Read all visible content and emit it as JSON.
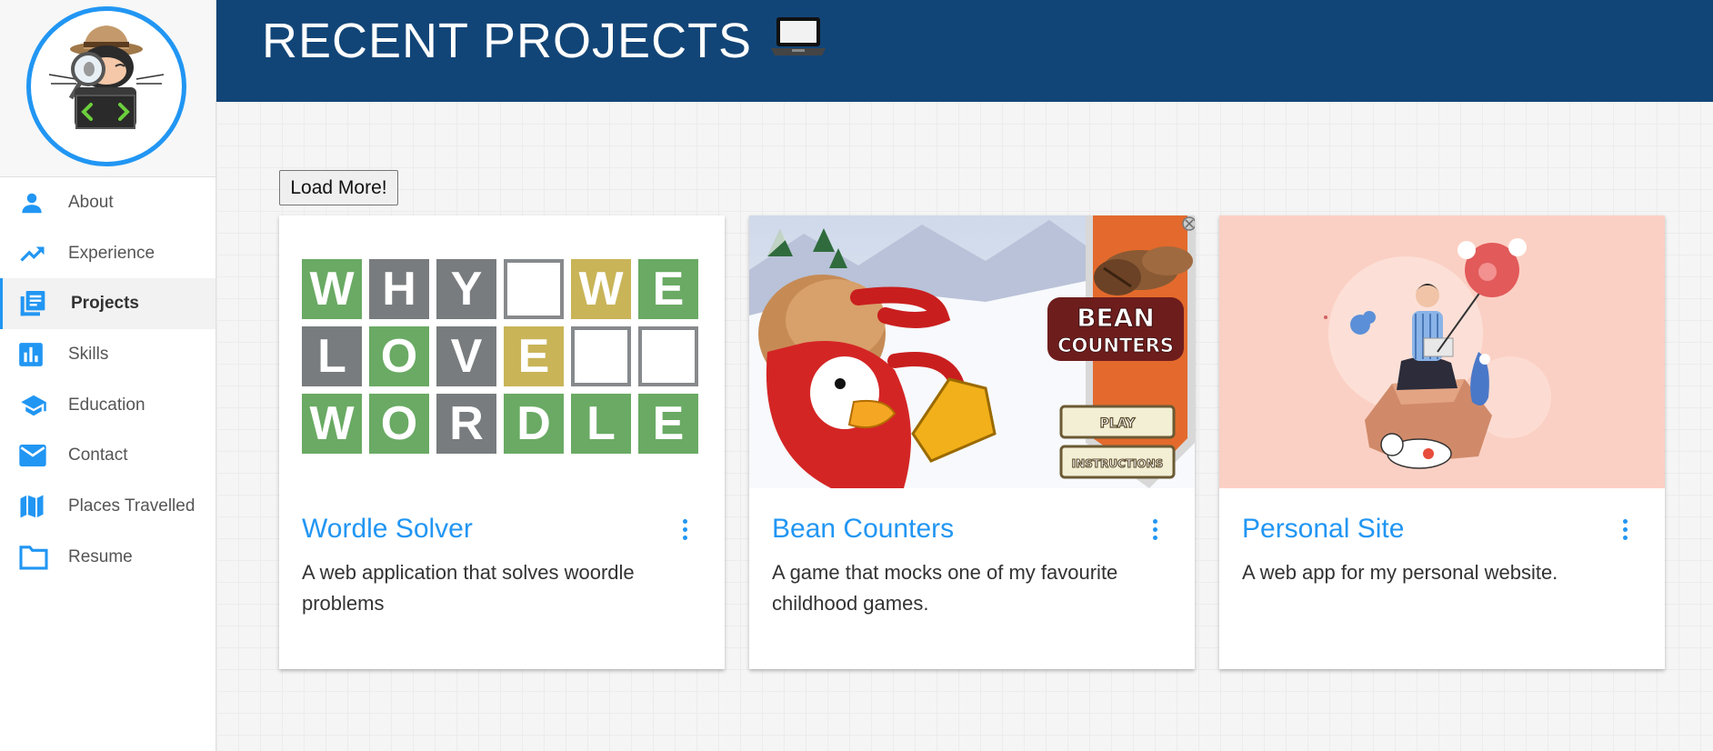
{
  "sidebar": {
    "items": [
      {
        "label": "About",
        "icon": "person-icon"
      },
      {
        "label": "Experience",
        "icon": "trending-up-icon"
      },
      {
        "label": "Projects",
        "icon": "projects-icon",
        "active": true
      },
      {
        "label": "Skills",
        "icon": "bar-chart-icon"
      },
      {
        "label": "Education",
        "icon": "school-icon"
      },
      {
        "label": "Contact",
        "icon": "mail-icon"
      },
      {
        "label": "Places Travelled",
        "icon": "map-icon"
      },
      {
        "label": "Resume",
        "icon": "folder-icon"
      }
    ]
  },
  "header": {
    "title": "RECENT PROJECTS",
    "emoji": "💻"
  },
  "main": {
    "load_more_label": "Load More!",
    "projects": [
      {
        "title": "Wordle Solver",
        "description": "A web application that solves woordle problems"
      },
      {
        "title": "Bean Counters",
        "description": "A game that mocks one of my favourite childhood games."
      },
      {
        "title": "Personal Site",
        "description": "A web app for my personal website."
      }
    ],
    "wordle_tiles": [
      {
        "letter": "W",
        "state": "g"
      },
      {
        "letter": "H",
        "state": "x"
      },
      {
        "letter": "Y",
        "state": "x"
      },
      {
        "letter": "",
        "state": "e"
      },
      {
        "letter": "W",
        "state": "y"
      },
      {
        "letter": "E",
        "state": "g"
      },
      {
        "letter": "L",
        "state": "x"
      },
      {
        "letter": "O",
        "state": "g"
      },
      {
        "letter": "V",
        "state": "x"
      },
      {
        "letter": "E",
        "state": "y"
      },
      {
        "letter": "",
        "state": "e"
      },
      {
        "letter": "",
        "state": "e"
      },
      {
        "letter": "W",
        "state": "g"
      },
      {
        "letter": "O",
        "state": "g"
      },
      {
        "letter": "R",
        "state": "x"
      },
      {
        "letter": "D",
        "state": "g"
      },
      {
        "letter": "L",
        "state": "g"
      },
      {
        "letter": "E",
        "state": "g"
      }
    ],
    "bean_counters_game": {
      "title_line1": "BEAN",
      "title_line2": "COUNTERS",
      "play_label": "PLAY",
      "instructions_label": "INSTRUCTIONS"
    }
  },
  "colors": {
    "accent": "#2196f3",
    "header_bg": "#124577",
    "wordle_green": "#6aaa64",
    "wordle_yellow": "#c9b458",
    "wordle_gray": "#787c7e",
    "personal_bg": "#fbd0c4"
  }
}
